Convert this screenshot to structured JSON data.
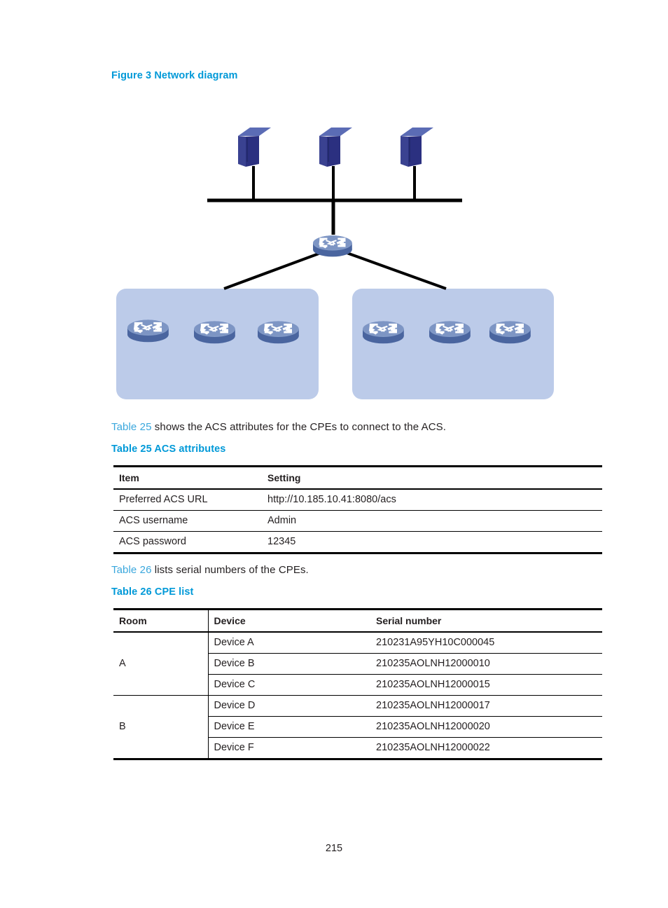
{
  "figure": {
    "caption": "Figure 3 Network diagram",
    "nodes": {
      "server_icon": "server-icon",
      "router_icon": "router-icon",
      "bus_line": "ethernet-bus-line",
      "group_box": "room-group-box"
    },
    "counts": {
      "servers": 3,
      "core_routers": 1,
      "group_boxes": 2,
      "routers_per_group": 3
    },
    "colors": {
      "server_front": "#2b3080",
      "server_top": "#5b6cb5",
      "server_side": "#3d4798",
      "router_body": "#7d95c4",
      "router_base": "#4a659f",
      "router_symbol": "#ffffff",
      "group_box_fill": "#bccbe9",
      "link_line": "#000000"
    }
  },
  "paragraphs": {
    "p_table25": {
      "link": "Table 25",
      "rest": " shows the ACS attributes for the CPEs to connect to the ACS."
    },
    "p_table26": {
      "link": "Table 26",
      "rest": " lists serial numbers of the CPEs."
    }
  },
  "table25": {
    "caption": "Table 25 ACS attributes",
    "headers": [
      "Item",
      "Setting"
    ],
    "rows": [
      [
        "Preferred ACS URL",
        "http://10.185.10.41:8080/acs"
      ],
      [
        "ACS username",
        "Admin"
      ],
      [
        "ACS password",
        "12345"
      ]
    ]
  },
  "table26": {
    "caption": "Table 26 CPE list",
    "headers": [
      "Room",
      "Device",
      "Serial number"
    ],
    "groups": [
      {
        "room": "A",
        "rows": [
          {
            "device": "Device A",
            "serial": "210231A95YH10C000045"
          },
          {
            "device": "Device B",
            "serial": "210235AOLNH12000010"
          },
          {
            "device": "Device C",
            "serial": "210235AOLNH12000015"
          }
        ]
      },
      {
        "room": "B",
        "rows": [
          {
            "device": "Device D",
            "serial": "210235AOLNH12000017"
          },
          {
            "device": "Device E",
            "serial": "210235AOLNH12000020"
          },
          {
            "device": "Device F",
            "serial": "210235AOLNH12000022"
          }
        ]
      }
    ]
  },
  "footer": {
    "page_number": "215"
  },
  "theme": {
    "heading_blue": "#0099d8",
    "link_blue": "#3aa7dd",
    "body_text": "#231f20"
  }
}
